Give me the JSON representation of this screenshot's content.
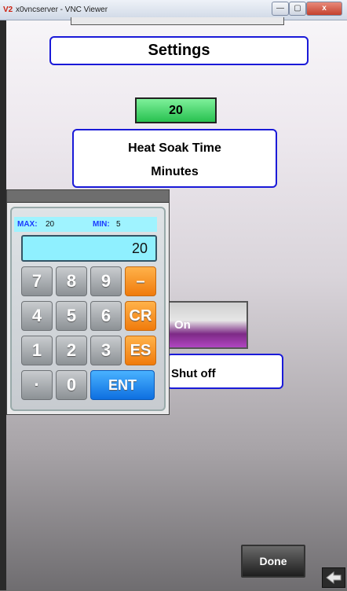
{
  "window": {
    "icon_text": "V2",
    "title": "x0vncserver - VNC Viewer",
    "min_label": "—",
    "max_label": "▢",
    "close_label": "x"
  },
  "screen": {
    "title": "Settings",
    "value": "20",
    "parameter_line1": "Heat Soak Time",
    "parameter_line2": "Minutes",
    "on_label": "On",
    "shutoff_label": "Shut off",
    "done_label": "Done",
    "back_icon": "arrow-left-icon"
  },
  "keypad": {
    "max_label": "MAX:",
    "max_value": "20",
    "min_label": "MIN:",
    "min_value": "5",
    "display_value": "20",
    "keys": [
      "7",
      "8",
      "9",
      "–",
      "4",
      "5",
      "6",
      "CR",
      "1",
      "2",
      "3",
      "ES",
      "·",
      "0",
      "ENT"
    ]
  },
  "colors": {
    "panel_border": "#1a1ad8",
    "value_green": "#28c150",
    "keypad_display": "#8ff0ff",
    "key_orange": "#f07b0c",
    "key_blue": "#0e6fe0",
    "on_purple": "#7d2a86"
  }
}
